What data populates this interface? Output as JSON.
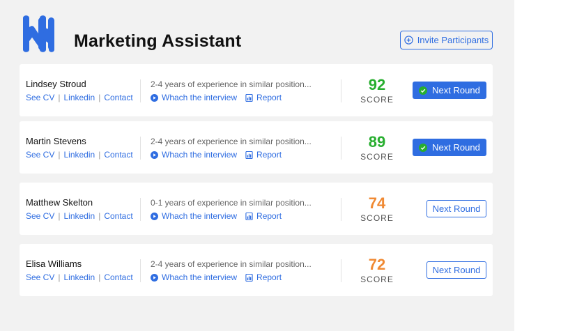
{
  "header": {
    "title": "Marketing Assistant",
    "invite_label": "Invite Participants"
  },
  "colors": {
    "accent": "#2f6de1",
    "score_high": "#27ae2f",
    "score_mid": "#f08a34",
    "panel_bg": "#f2f2f2"
  },
  "icons": {
    "logo": "logo-icon",
    "invite": "plus-circle-icon",
    "watch": "play-circle-icon",
    "report": "report-chart-icon",
    "selected": "check-circle-icon"
  },
  "candidates": [
    {
      "name": "Lindsey Stroud",
      "see_cv": "See CV",
      "linkedin": "Linkedin",
      "contact": "Contact",
      "experience": "2-4 years of experience in similar position...",
      "watch": "Whach the interview",
      "report": "Report",
      "score": "92",
      "score_label": "SCORE",
      "next": "Next Round",
      "selected": true
    },
    {
      "name": "Martin Stevens",
      "see_cv": "See CV",
      "linkedin": "Linkedin",
      "contact": "Contact",
      "experience": "2-4 years of experience in similar position...",
      "watch": "Whach the interview",
      "report": "Report",
      "score": "89",
      "score_label": "SCORE",
      "next": "Next Round",
      "selected": true
    },
    {
      "name": "Matthew Skelton",
      "see_cv": "See CV",
      "linkedin": "Linkedin",
      "contact": "Contact",
      "experience": "0-1 years of experience in similar position...",
      "watch": "Whach the interview",
      "report": "Report",
      "score": "74",
      "score_label": "SCORE",
      "next": "Next Round",
      "selected": false
    },
    {
      "name": "Elisa Williams",
      "see_cv": "See CV",
      "linkedin": "Linkedin",
      "contact": "Contact",
      "experience": "2-4 years of experience in similar position...",
      "watch": "Whach the interview",
      "report": "Report",
      "score": "72",
      "score_label": "SCORE",
      "next": "Next Round",
      "selected": false
    }
  ]
}
